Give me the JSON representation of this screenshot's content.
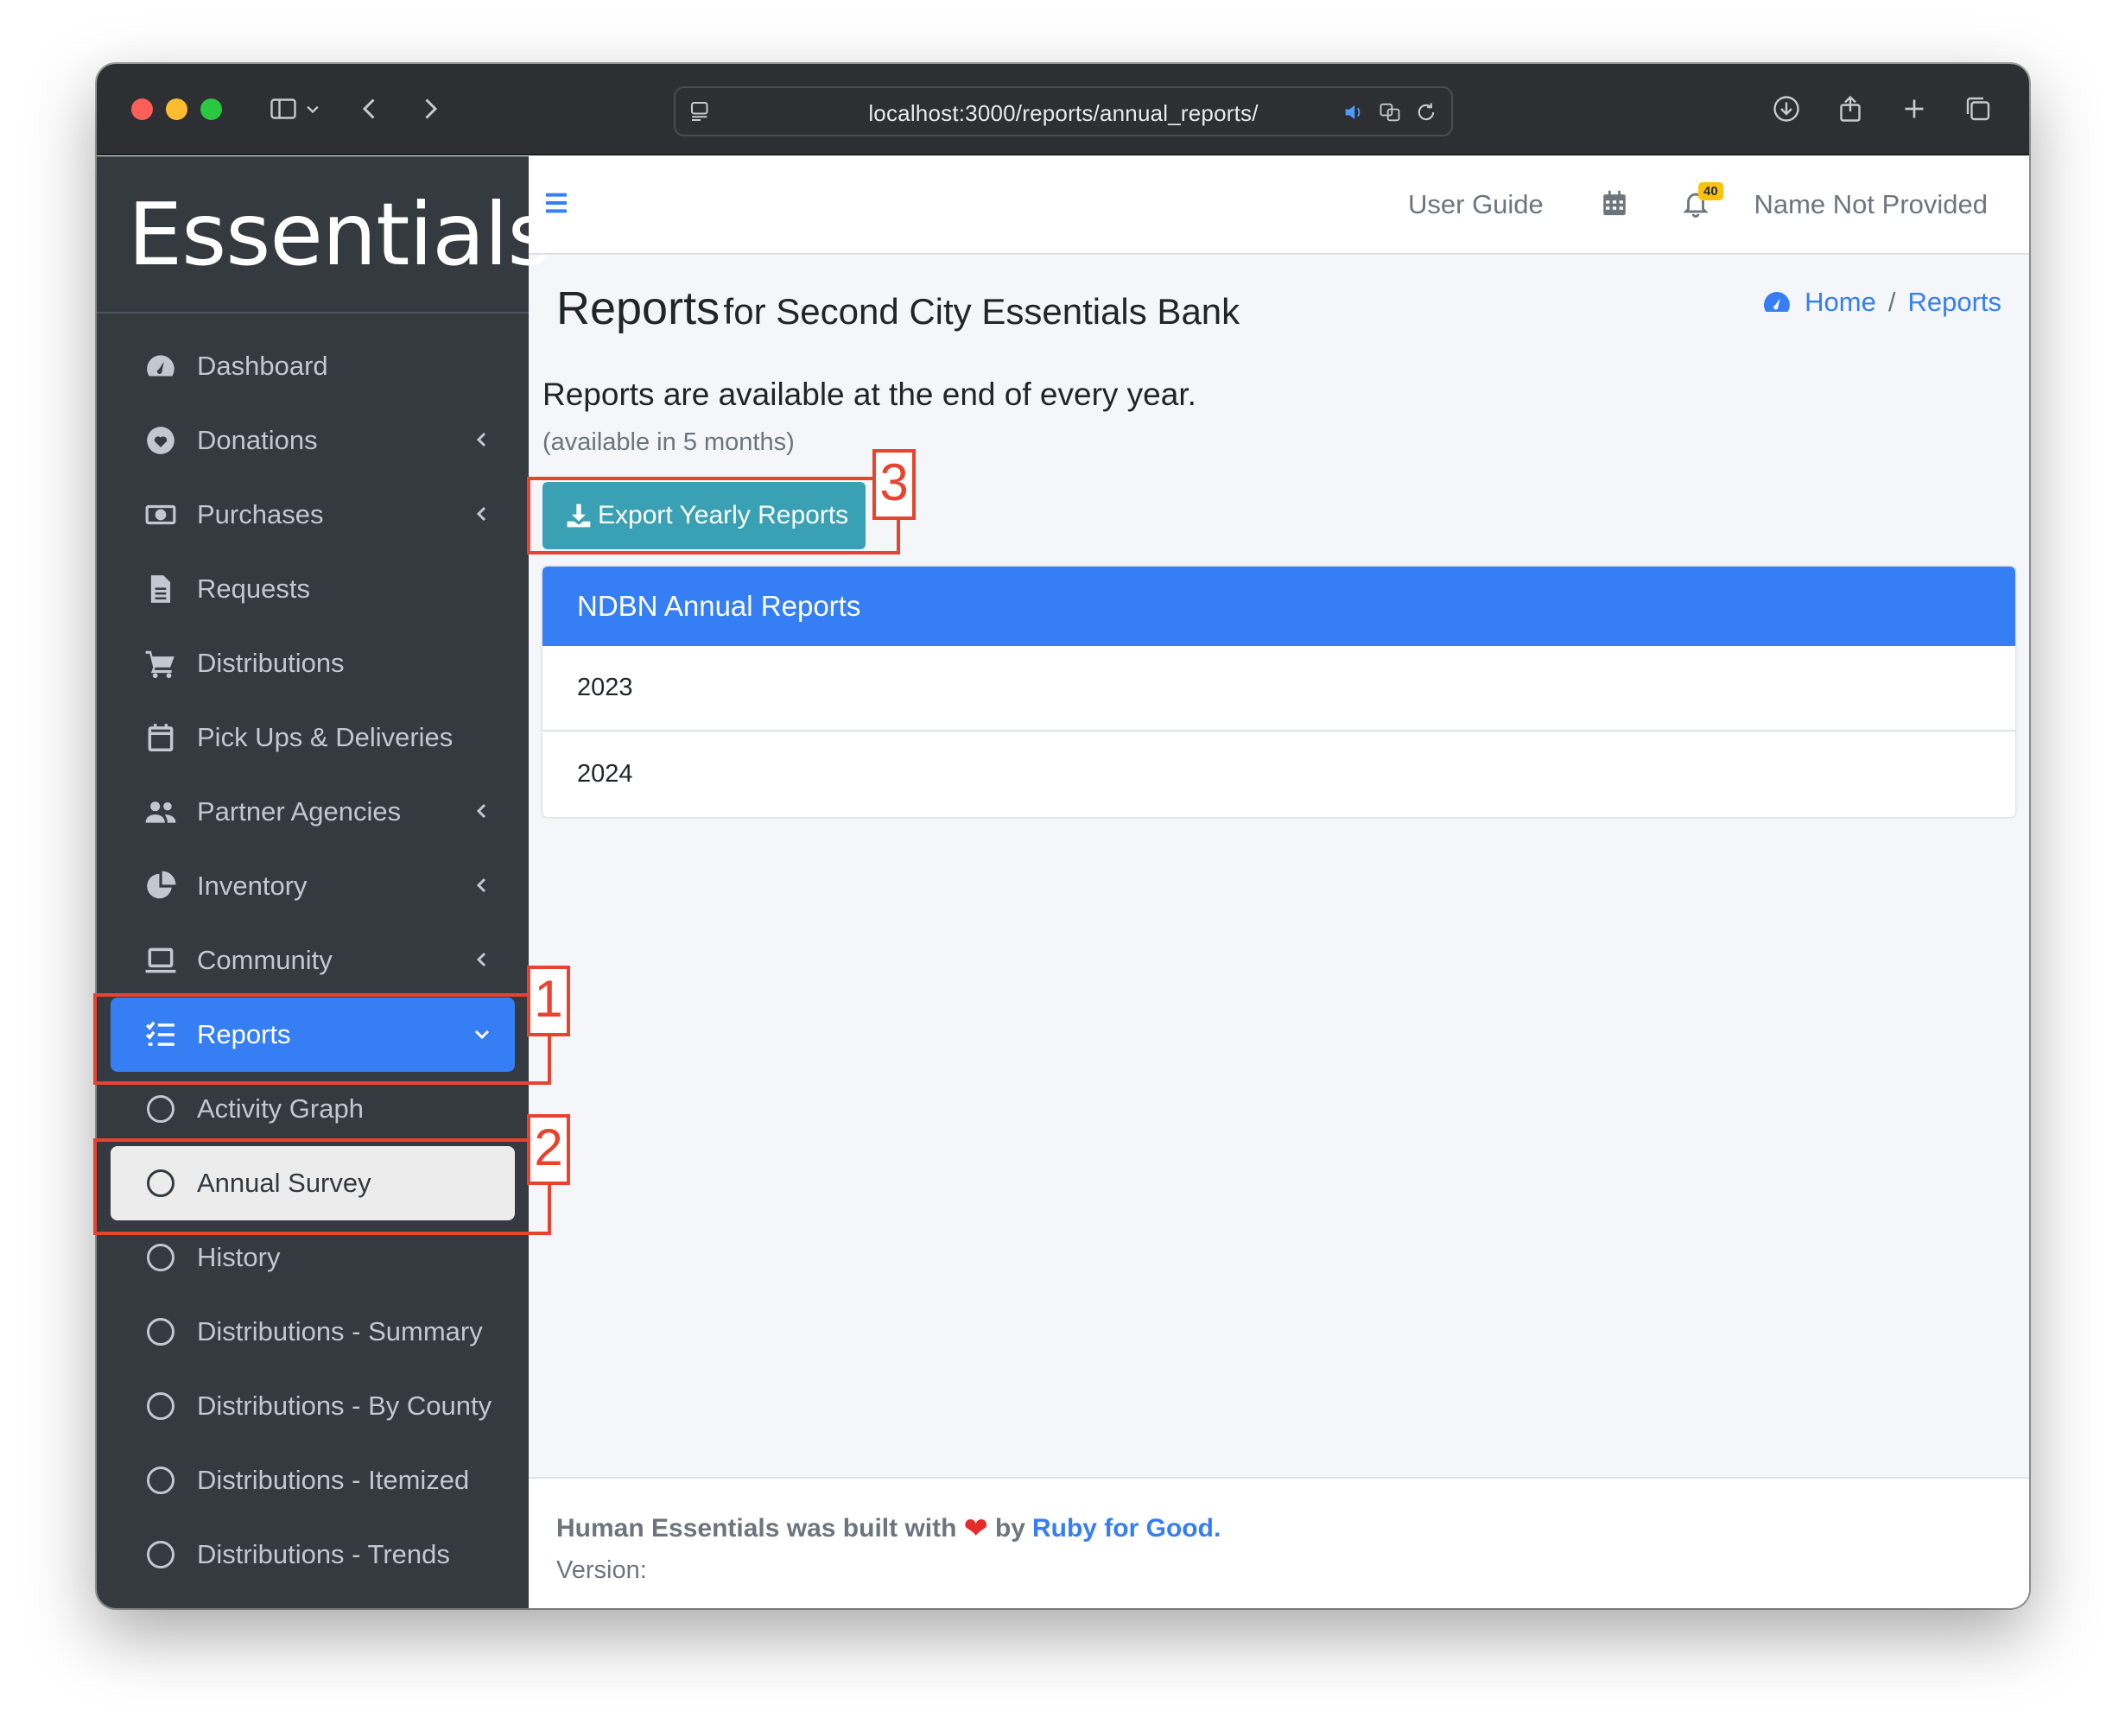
{
  "browser": {
    "url": "localhost:3000/reports/annual_reports/"
  },
  "sidebar": {
    "brand": "Essentials",
    "items": [
      {
        "label": "Dashboard"
      },
      {
        "label": "Donations"
      },
      {
        "label": "Purchases"
      },
      {
        "label": "Requests"
      },
      {
        "label": "Distributions"
      },
      {
        "label": "Pick Ups & Deliveries"
      },
      {
        "label": "Partner Agencies"
      },
      {
        "label": "Inventory"
      },
      {
        "label": "Community"
      },
      {
        "label": "Reports"
      }
    ],
    "sub_items": [
      {
        "label": "Activity Graph"
      },
      {
        "label": "Annual Survey"
      },
      {
        "label": "History"
      },
      {
        "label": "Distributions - Summary"
      },
      {
        "label": "Distributions - By County"
      },
      {
        "label": "Distributions - Itemized"
      },
      {
        "label": "Distributions - Trends"
      }
    ]
  },
  "topnav": {
    "user_guide": "User Guide",
    "notification_count": "40",
    "user_name": "Name Not Provided"
  },
  "page": {
    "title": "Reports",
    "subtitle": "for Second City Essentials Bank",
    "breadcrumb_home": "Home",
    "breadcrumb_sep": "/",
    "breadcrumb_current": "Reports",
    "availability_lead": "Reports are available at the end of every year.",
    "availability_sub": "(available in 5 months)",
    "export_button": "Export Yearly Reports",
    "card_title": "NDBN Annual Reports",
    "years": [
      "2023",
      "2024"
    ]
  },
  "footer": {
    "built_with": "Human Essentials was built with",
    "by": "by",
    "org": "Ruby for Good",
    "period": ".",
    "version_label": "Version:"
  },
  "annotations": [
    "1",
    "2",
    "3"
  ],
  "colors": {
    "sidebar_bg": "#343a40",
    "accent": "#357ef4",
    "export_btn": "#3aa0b4",
    "annotation": "#e8432e"
  }
}
